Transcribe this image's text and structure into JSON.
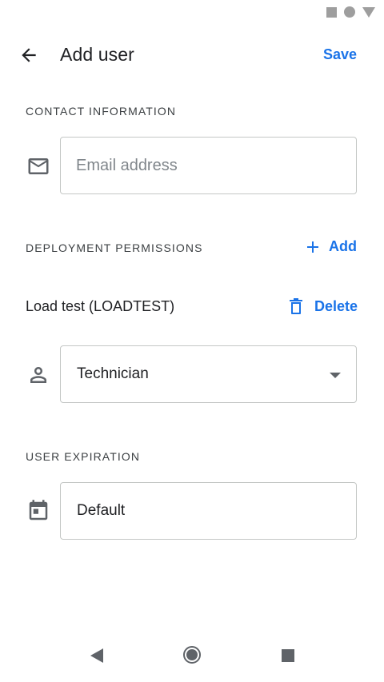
{
  "app_bar": {
    "title": "Add user",
    "save_label": "Save"
  },
  "contact": {
    "header": "CONTACT INFORMATION",
    "email_placeholder": "Email address",
    "email_value": ""
  },
  "permissions": {
    "header": "DEPLOYMENT PERMISSIONS",
    "add_label": "Add",
    "deployment_name": "Load test (LOADTEST)",
    "delete_label": "Delete",
    "role_selected": "Technician"
  },
  "expiration": {
    "header": "USER EXPIRATION",
    "value": "Default"
  },
  "colors": {
    "accent": "#1a73e8",
    "text_primary": "#202124",
    "border": "#c4c7c5",
    "icon": "#5f6368"
  },
  "icons": {
    "back": "arrow-back-icon",
    "email": "mail-icon",
    "add": "plus-icon",
    "delete": "trash-icon",
    "person": "person-icon",
    "calendar": "calendar-icon"
  }
}
